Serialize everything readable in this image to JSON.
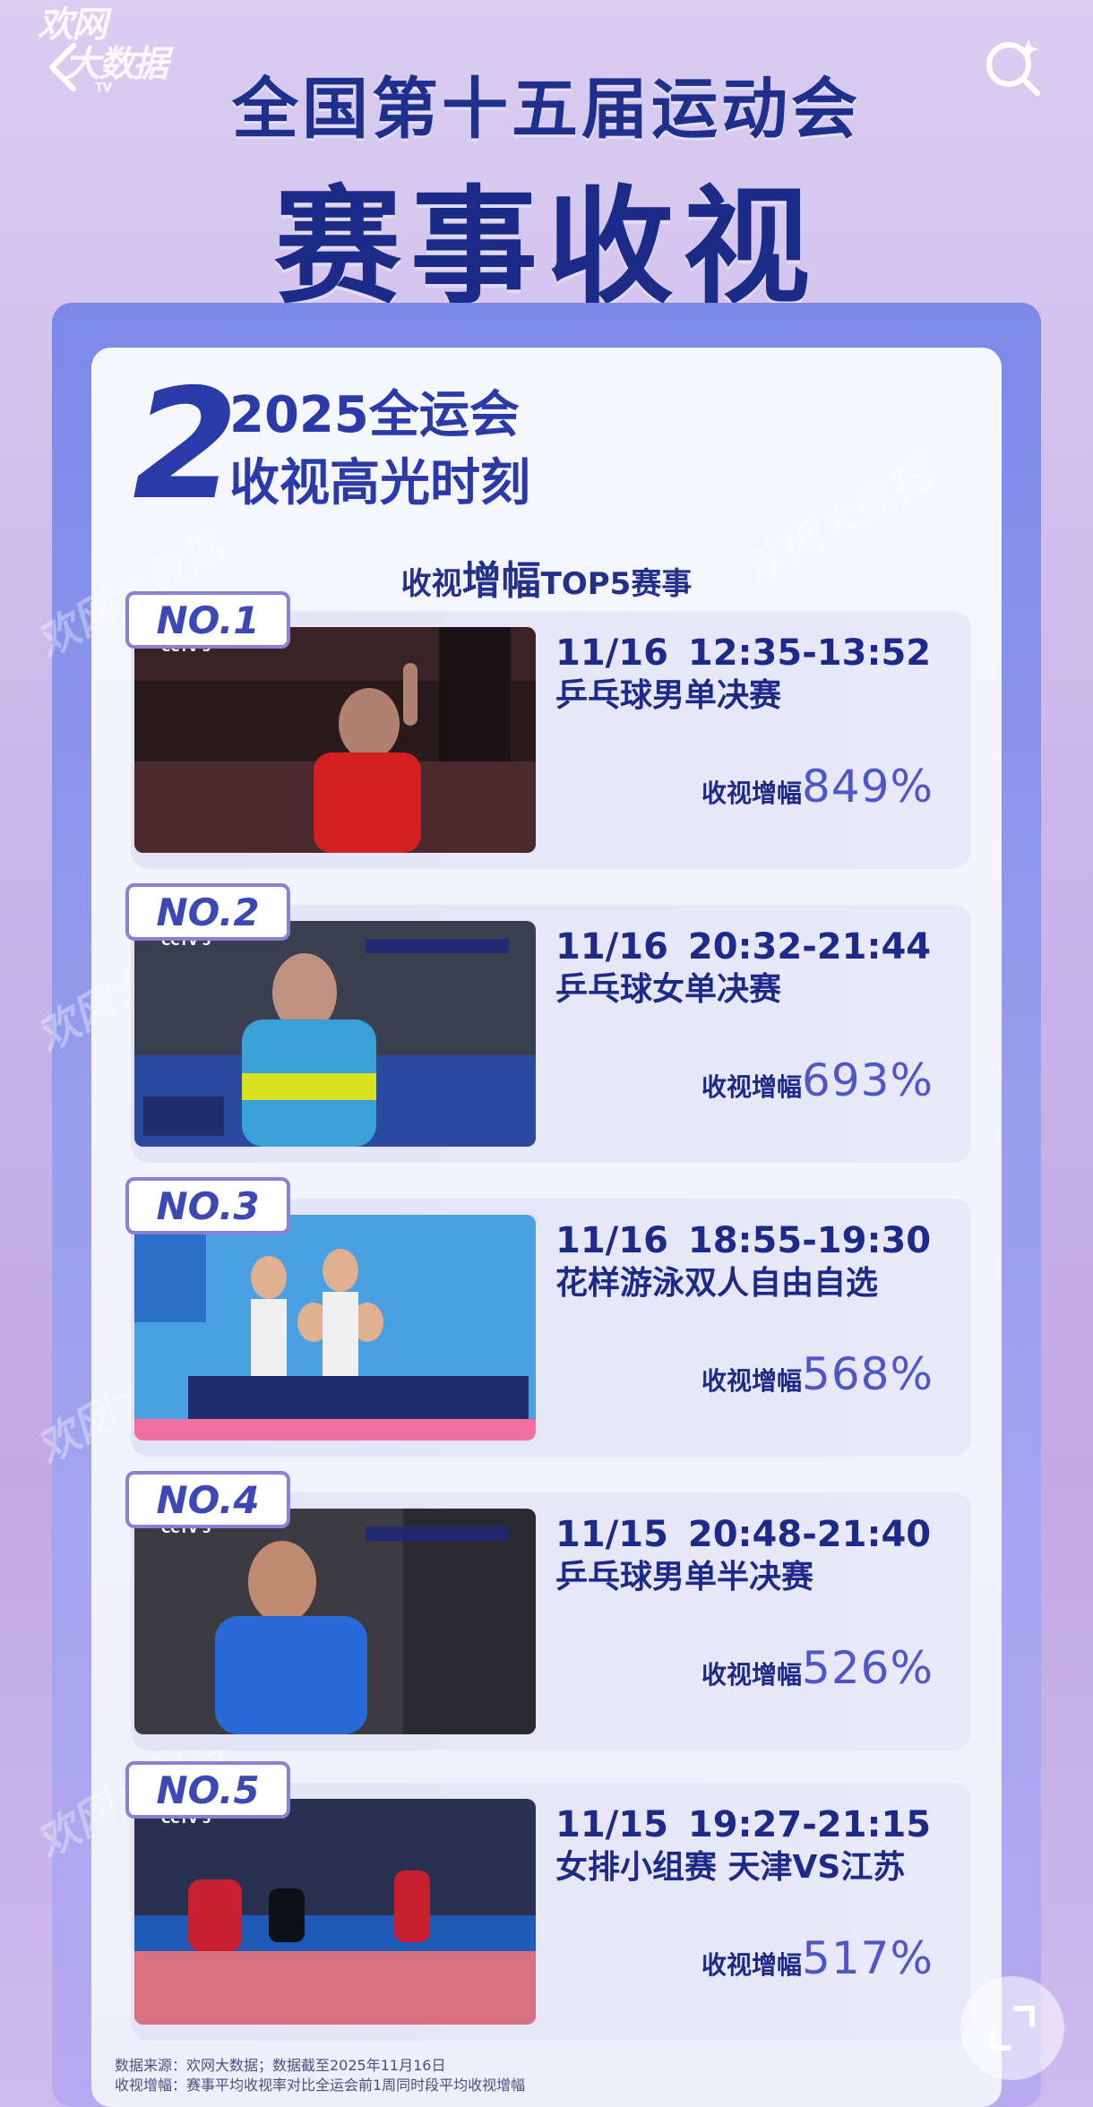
{
  "header": {
    "logo_line1": "欢网",
    "logo_line2": "大数据",
    "logo_tv": "TV",
    "title1": "全国第十五届运动会",
    "title2": "赛事收视"
  },
  "section": {
    "number": "2",
    "title_line1": "2025全运会",
    "title_line2": "收视高光时刻",
    "subheading_pre": "收视",
    "subheading_big": "增幅",
    "subheading_post": "TOP5赛事"
  },
  "cards": [
    {
      "rank": "NO.1",
      "time": "11/16  12:35-13:52",
      "event": "乒乓球男单决赛",
      "rate_label": "收视增幅",
      "rate_value": "849%",
      "channel": "CCTV 5"
    },
    {
      "rank": "NO.2",
      "time": "11/16  20:32-21:44",
      "event": "乒乓球女单决赛",
      "rate_label": "收视增幅",
      "rate_value": "693%",
      "channel": "CCTV 5"
    },
    {
      "rank": "NO.3",
      "time": "11/16  18:55-19:30",
      "event": "花样游泳双人自由自选",
      "rate_label": "收视增幅",
      "rate_value": "568%",
      "channel": ""
    },
    {
      "rank": "NO.4",
      "time": "11/15  20:48-21:40",
      "event": "乒乓球男单半决赛",
      "rate_label": "收视增幅",
      "rate_value": "526%",
      "channel": "CCTV 5"
    },
    {
      "rank": "NO.5",
      "time": "11/15  19:27-21:15",
      "event": "女排小组赛 天津VS江苏",
      "rate_label": "收视增幅",
      "rate_value": "517%",
      "channel": "CCTV 5"
    }
  ],
  "footer": {
    "line1": "数据来源：欢网大数据；数据截至2025年11月16日",
    "line2": "收视增幅：赛事平均收视率对比全运会前1周同时段平均收视增幅"
  },
  "watermark_text": "欢网大数据",
  "colors": {
    "brand_navy": "#1e2a8a",
    "accent_purple": "#4f56c8",
    "tag_border": "#8c7fd8"
  },
  "icons": [
    "back-arrow-icon",
    "search-sparkle-icon",
    "expand-corners-icon"
  ]
}
